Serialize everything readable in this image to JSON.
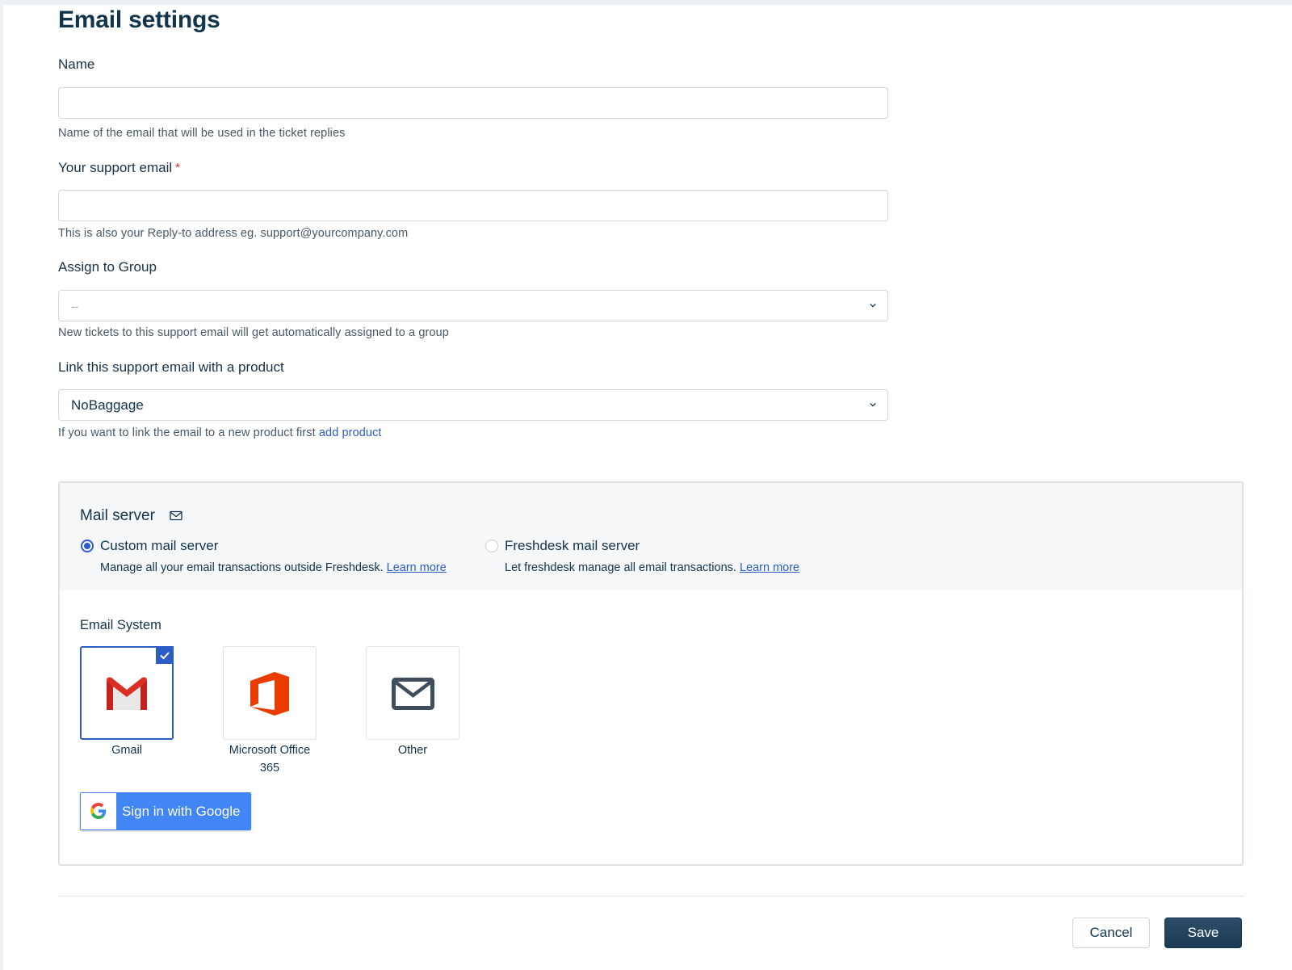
{
  "page": {
    "title": "Email settings"
  },
  "name_field": {
    "label": "Name",
    "value": "",
    "hint": "Name of the email that will be used in the ticket replies"
  },
  "support_email_field": {
    "label": "Your support email",
    "required_mark": "*",
    "value": "",
    "hint": "This is also your Reply-to address eg. support@yourcompany.com"
  },
  "group_field": {
    "label": "Assign to Group",
    "selected": "--",
    "hint": "New tickets to this support email will get automatically assigned to a group"
  },
  "product_field": {
    "label": "Link this support email with a product",
    "selected": "NoBaggage",
    "hint": "If you want to link the email to a new product first",
    "hint_link": "add product"
  },
  "mail_server": {
    "title": "Mail server",
    "options": [
      {
        "label": "Custom mail server",
        "description": "Manage all your email transactions outside Freshdesk.",
        "link": "Learn more",
        "selected": true
      },
      {
        "label": "Freshdesk mail server",
        "description": "Let freshdesk manage all email transactions.",
        "link": "Learn more",
        "selected": false
      }
    ],
    "email_system": {
      "label": "Email System",
      "tiles": [
        {
          "name": "Gmail",
          "icon": "gmail-icon",
          "selected": true
        },
        {
          "name_line1": "Microsoft Office",
          "name_line2": "365",
          "icon": "office365-icon",
          "selected": false
        },
        {
          "name": "Other",
          "icon": "envelope-icon",
          "selected": false
        }
      ]
    },
    "google_button": {
      "label": "Sign in with Google",
      "icon": "google-g-icon"
    }
  },
  "footer": {
    "cancel_label": "Cancel",
    "save_label": "Save"
  },
  "colors": {
    "accent": "#2c5cc5",
    "primary_button": "#264966",
    "google_blue": "#4285f4",
    "required": "#d72d30",
    "office_orange": "#eb3c00",
    "gmail_red": "#d93025"
  }
}
